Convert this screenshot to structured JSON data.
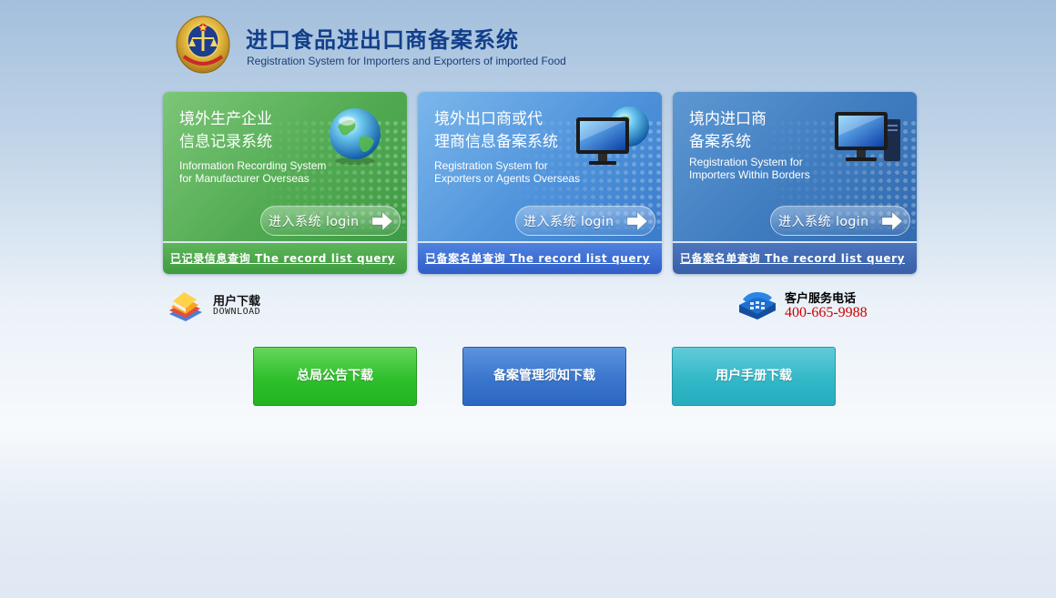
{
  "header": {
    "title_cn": "进口食品进出口商备案系统",
    "title_en": "Registration System for Importers and Exporters of imported Food",
    "emblem_icon": "national-emblem-icon"
  },
  "cards": [
    {
      "title_lines": [
        "境外生产企业",
        "信息记录系统"
      ],
      "subtitle_lines": [
        "Information Recording System",
        "for Manufacturer Overseas"
      ],
      "icon": "globe-icon",
      "login_label": "进入系统  login",
      "query_label": "已记录信息查询  The record list query",
      "color": "#52ab52"
    },
    {
      "title_lines": [
        "境外出口商或代",
        "理商信息备案系统"
      ],
      "subtitle_lines": [
        "Registration System for",
        "Exporters or Agents Overseas"
      ],
      "icon": "monitor-globe-icon",
      "login_label": "进入系统  login",
      "query_label": "已备案名单查询  The record list query",
      "color": "#4f93db"
    },
    {
      "title_lines": [
        "境内进口商",
        "备案系统"
      ],
      "subtitle_lines": [
        "Registration System for",
        "Importers Within Borders"
      ],
      "icon": "computer-icon",
      "login_label": "进入系统  login",
      "query_label": "已备案名单查询  The record list query",
      "color": "#3f7cbf"
    }
  ],
  "download": {
    "label_cn": "用户下载",
    "label_en": "DOWNLOAD",
    "icon": "books-icon"
  },
  "service": {
    "label": "客户服务电话",
    "number": "400-665-9988",
    "icon": "telephone-icon",
    "number_color": "#d00000"
  },
  "buttons": [
    {
      "label": "总局公告下载",
      "color": "#2fbf2c"
    },
    {
      "label": "备案管理须知下载",
      "color": "#3a76cd"
    },
    {
      "label": "用户手册下载",
      "color": "#33b8c8"
    }
  ]
}
